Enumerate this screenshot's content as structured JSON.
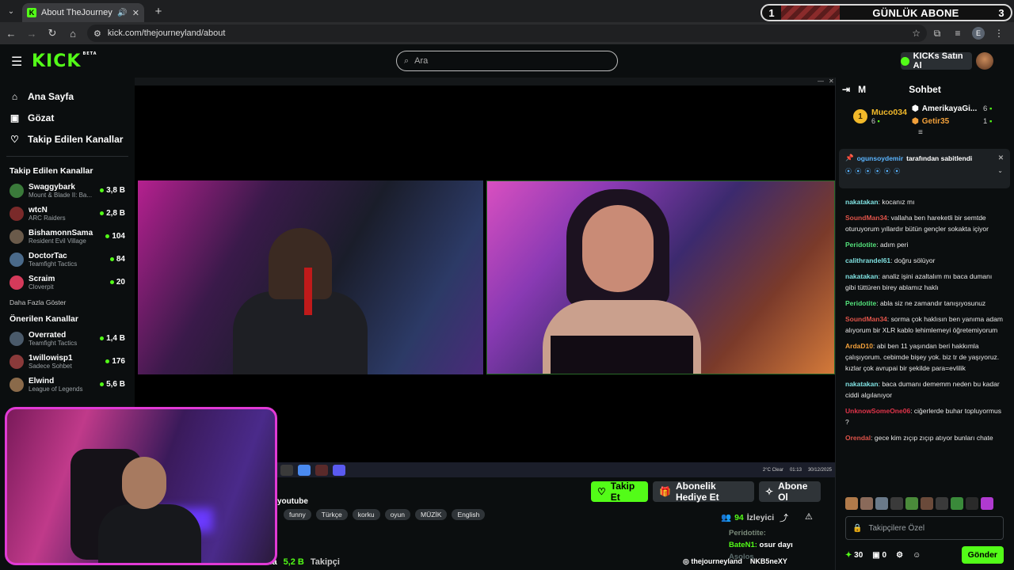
{
  "browser": {
    "tab_title": "About TheJourneyLand - W",
    "url": "kick.com/thejourneyland/about",
    "profile_letter": "E"
  },
  "overlay_banner": {
    "left_count": "1",
    "label": "GÜNLÜK ABONE",
    "right_count": "3"
  },
  "header": {
    "search_placeholder": "Ara",
    "kicks_button": "KICKs Satın Al",
    "logo": "KICK",
    "logo_badge": "BETA"
  },
  "sidebar": {
    "main": [
      {
        "label": "Ana Sayfa",
        "icon": "home-icon"
      },
      {
        "label": "Gözat",
        "icon": "browse-icon"
      },
      {
        "label": "Takip Edilen Kanallar",
        "icon": "heart-icon"
      }
    ],
    "followed_title": "Takip Edilen Kanallar",
    "followed": [
      {
        "name": "Swaggybark",
        "game": "Mount & Blade II: Ba...",
        "viewers": "3,8 B",
        "color": "#3a7a3a"
      },
      {
        "name": "wtcN",
        "game": "ARC Raiders",
        "viewers": "2,8 B",
        "color": "#7a2a2a"
      },
      {
        "name": "BishamonnSama",
        "game": "Resident Evil Village",
        "viewers": "104",
        "color": "#6a5a4a"
      },
      {
        "name": "DoctorTac",
        "game": "Teamfight Tactics",
        "viewers": "84",
        "color": "#4a6a8a"
      },
      {
        "name": "Scraim",
        "game": "Cloverpit",
        "viewers": "20",
        "color": "#d43a5a"
      }
    ],
    "more_label": "Daha Fazla Göster",
    "recommended_title": "Önerilen Kanallar",
    "recommended": [
      {
        "name": "Overrated",
        "game": "Teamfight Tactics",
        "viewers": "1,4 B",
        "color": "#4a5a6a"
      },
      {
        "name": "1willowisp1",
        "game": "Sadece Sohbet",
        "viewers": "176",
        "color": "#8a3a3a"
      },
      {
        "name": "Elwind",
        "game": "League of Legends",
        "viewers": "5,6 B",
        "color": "#8a6a4a"
      }
    ]
  },
  "stream": {
    "follow_label": "Takip Et",
    "gift_label": "Abonelik Hediye Et",
    "subscribe_label": "Abone Ol",
    "source_text": "youtube",
    "tags": [
      "funny",
      "Türkçe",
      "korku",
      "oyun",
      "MÜZİK",
      "English"
    ],
    "viewer_count": "94",
    "viewer_label": "İzleyici",
    "follower_count": "5,2 B",
    "follower_label": "Takipçi",
    "follower_prefix": "nda",
    "social_handle": "thejourneyland",
    "social_handle2": "NKB5neXY",
    "taskbar_weather": "2°C Clear",
    "taskbar_time": "01:13",
    "taskbar_date": "30/12/2025"
  },
  "overlay_chat": [
    {
      "user": "Peridotite:",
      "text": "",
      "color": "#7a8a7a"
    },
    {
      "user": "BateN1:",
      "text": "osur dayı",
      "color": "#53fc18"
    },
    {
      "user": "Asolos",
      "text": "",
      "color": "#5a6a6a"
    }
  ],
  "chat": {
    "title": "Sohbet",
    "mode_letter": "M",
    "top_gifter": {
      "rank": "1",
      "name": "Muco034",
      "count": "6"
    },
    "gifter2": {
      "name": "AmerikayaGi...",
      "count": "6"
    },
    "gifter3": {
      "name": "Getir35",
      "count": "1"
    },
    "pinned_by_user": "ogunsoydemir",
    "pinned_label": "tarafından sabitlendi",
    "pinned_text": "⦿ ⦿ ⦿ ⦿ ⦿ ⦿",
    "messages": [
      {
        "user": "nakatakan",
        "text": "kocanız mı",
        "color": "#7fe0e0"
      },
      {
        "user": "SoundMan34",
        "text": "vallaha ben hareketli bir semtde oturuyorum yıllardır bütün gençler sokakta içiyor",
        "color": "#e0544a"
      },
      {
        "user": "Peridotite",
        "text": "adım peri",
        "color": "#53e07a"
      },
      {
        "user": "calithrandel61",
        "text": "doğru sölüyor",
        "color": "#7fe0e0"
      },
      {
        "user": "nakatakan",
        "text": "analiz işini azaltalım mı baca dumanı gibi tüttüren birey ablamız haklı",
        "color": "#7fe0e0"
      },
      {
        "user": "Peridotite",
        "text": "abla siz ne zamandır tanışıyosunuz",
        "color": "#53e07a"
      },
      {
        "user": "SoundMan34",
        "text": "sorma çok haklısın ben yanıma adam alıyorum bir XLR kablo lehimlemeyi öğretemiyorum",
        "color": "#e0544a"
      },
      {
        "user": "ArdaD10",
        "text": "abi ben 11 yaşından beri hakkımla çalışıyorum. cebimde bişey yok. biz tr de yaşıyoruz. kızlar çok avrupai bir şekilde para=evlilik",
        "color": "#f2a03a"
      },
      {
        "user": "nakatakan",
        "text": "baca dumanı dememm neden bu kadar ciddi algılanıyor",
        "color": "#7fe0e0"
      },
      {
        "user": "UnknowSomeOne06",
        "text": "ciğerlerde buhar topluyormus ?",
        "color": "#e0344a"
      },
      {
        "user": "Orendal",
        "text": "gece kim zıçıp zıçıp atıyor bunları chate",
        "color": "#e0544a"
      }
    ],
    "input_placeholder": "Takipçilere Özel",
    "kicks_count": "30",
    "chest_count": "0",
    "send_label": "Gönder"
  }
}
